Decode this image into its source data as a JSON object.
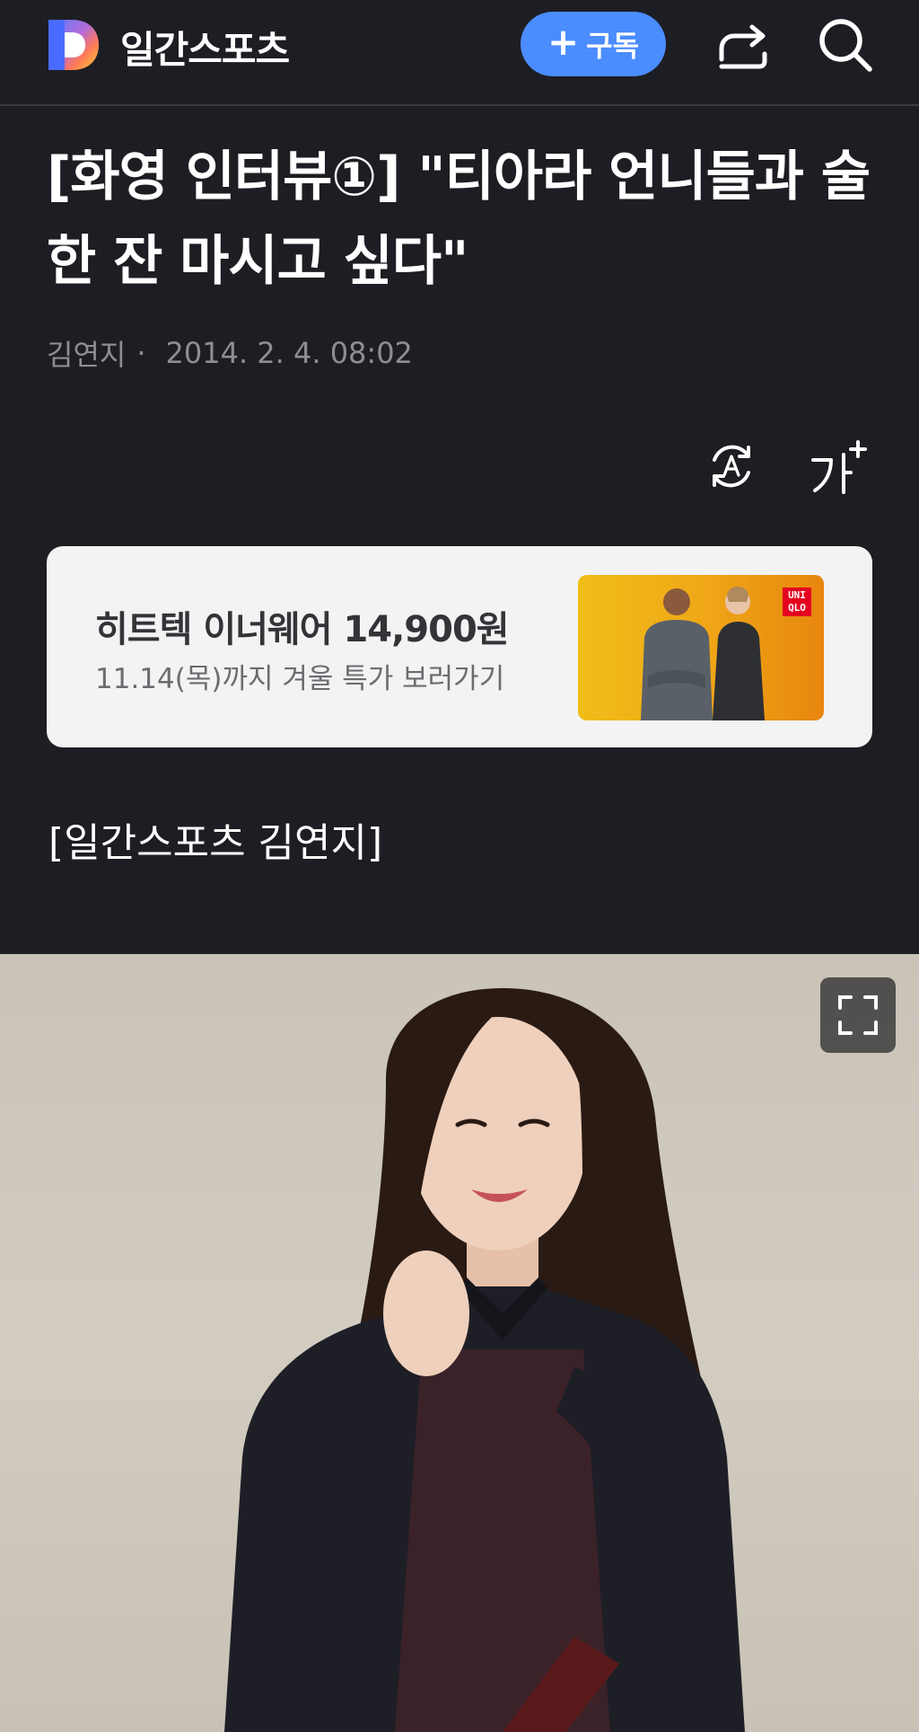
{
  "header": {
    "site_name": "일간스포츠",
    "subscribe_label": "구독",
    "subscribe_plus": "+",
    "icons": [
      "logo-icon",
      "share-icon",
      "search-icon"
    ],
    "accent_color": "#4b8cff"
  },
  "article": {
    "title": "[화영 인터뷰①] \"티아라 언니들과 술 한 잔 마시고 싶다\"",
    "author": "김연지",
    "separator": "·",
    "datetime": "2014. 2. 4. 08:02",
    "tools": [
      "translate-icon",
      "font-size-icon"
    ],
    "font_size_glyph": "가",
    "byline": "[일간스포츠 김연지]"
  },
  "ad": {
    "title": "히트텍 이너웨어 14,900원",
    "subtitle": "11.14(목)까지 겨울 특가 보러가기",
    "brand_badge_line1": "UNI",
    "brand_badge_line2": "QLO",
    "brand_color": "#e5001f"
  },
  "photo": {
    "expand_icon": "expand-icon",
    "background_color": "#cdc7bc"
  }
}
